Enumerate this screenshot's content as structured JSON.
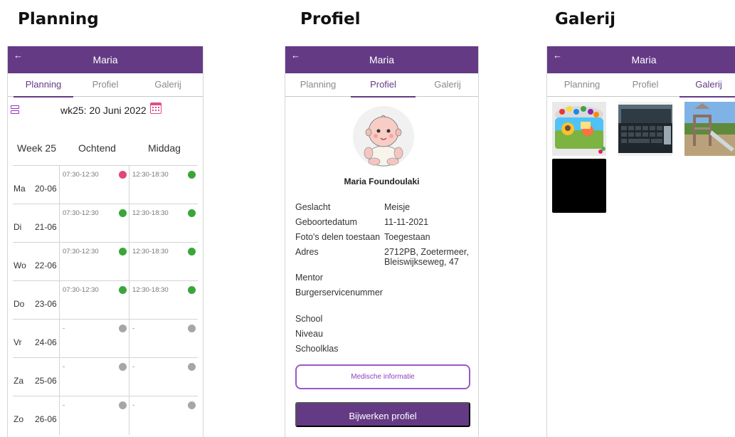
{
  "captions": {
    "planning": "Planning",
    "profiel": "Profiel",
    "galerij": "Galerij"
  },
  "appbar": {
    "back": "←",
    "title": "Maria"
  },
  "tabs": [
    "Planning",
    "Profiel",
    "Galerij"
  ],
  "planning": {
    "week_label": "wk25: 20 Juni 2022",
    "headers": {
      "week": "Week 25",
      "morning": "Ochtend",
      "afternoon": "Middag"
    },
    "days": [
      {
        "name": "Ma",
        "date": "20-06",
        "morning": "07:30-12:30",
        "morning_status": "#e0467c",
        "afternoon": "12:30-18:30",
        "afternoon_status": "#3aa63a"
      },
      {
        "name": "Di",
        "date": "21-06",
        "morning": "07:30-12:30",
        "morning_status": "#3aa63a",
        "afternoon": "12:30-18:30",
        "afternoon_status": "#3aa63a"
      },
      {
        "name": "Wo",
        "date": "22-06",
        "morning": "07:30-12:30",
        "morning_status": "#3aa63a",
        "afternoon": "12:30-18:30",
        "afternoon_status": "#3aa63a"
      },
      {
        "name": "Do",
        "date": "23-06",
        "morning": "07:30-12:30",
        "morning_status": "#3aa63a",
        "afternoon": "12:30-18:30",
        "afternoon_status": "#3aa63a"
      },
      {
        "name": "Vr",
        "date": "24-06",
        "morning": "-",
        "morning_status": "#a6a6a6",
        "afternoon": "-",
        "afternoon_status": "#a6a6a6"
      },
      {
        "name": "Za",
        "date": "25-06",
        "morning": "-",
        "morning_status": "#a6a6a6",
        "afternoon": "-",
        "afternoon_status": "#a6a6a6"
      },
      {
        "name": "Zo",
        "date": "26-06",
        "morning": "-",
        "morning_status": "#a6a6a6",
        "afternoon": "-",
        "afternoon_status": "#a6a6a6"
      }
    ]
  },
  "profiel": {
    "name": "Maria Foundoulaki",
    "fields": [
      {
        "label": "Geslacht",
        "value": "Meisje"
      },
      {
        "label": "Geboortedatum",
        "value": "11-11-2021"
      },
      {
        "label": "Foto's delen toestaan",
        "value": "Toegestaan"
      },
      {
        "label": "Adres",
        "value": "2712PB, Zoetermeer, Bleiswijkseweg, 47"
      },
      {
        "label": "Mentor",
        "value": ""
      },
      {
        "label": "Burgerservicenummer",
        "value": ""
      },
      {
        "label": "School",
        "value": ""
      },
      {
        "label": "Niveau",
        "value": ""
      },
      {
        "label": "Schoolklas",
        "value": ""
      }
    ],
    "medical_button": "Medische informatie",
    "update_button": "Bijwerken profiel"
  },
  "colors": {
    "primary": "#643a85",
    "accent": "#9c2fc4",
    "calendar": "#e24a86"
  }
}
